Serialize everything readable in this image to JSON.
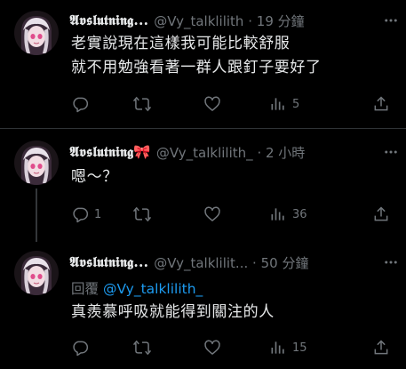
{
  "posts": [
    {
      "name": "𝕬𝖛𝖘𝖑𝖚𝖙𝖓𝖎𝖓𝖌...",
      "handle": "@Vy_talklilith",
      "sep": "·",
      "time": "19 分鐘",
      "lines": [
        "老實說現在這樣我可能比較舒服",
        "就不用勉強看著一群人跟釘子要好了"
      ],
      "stats": {
        "reply": "",
        "repost": "",
        "like": "",
        "views": "5"
      }
    },
    {
      "name": "𝕬𝖛𝖘𝖑𝖚𝖙𝖓𝖎𝖓𝖌",
      "emoji": "🎀",
      "handle": "@Vy_talklilith_",
      "sep": "·",
      "time": "2 小時",
      "lines": [
        "嗯～？"
      ],
      "stats": {
        "reply": "1",
        "repost": "",
        "like": "",
        "views": "36"
      }
    },
    {
      "name": "𝕬𝖛𝖘𝖑𝖚𝖙𝖓𝖎𝖓𝖌...",
      "handle": "@Vy_talklilit...",
      "sep": "·",
      "time": "50 分鐘",
      "reply_prefix": "回覆",
      "reply_to": "@Vy_talklilith_",
      "lines": [
        "真羨慕呼吸就能得到關注的人"
      ],
      "stats": {
        "reply": "",
        "repost": "",
        "like": "",
        "views": "15"
      }
    }
  ],
  "colors": {
    "accent": "#1d9bf0",
    "muted": "#71767b",
    "text": "#e7e9ea",
    "bg": "#000000"
  },
  "icons": [
    "more-icon",
    "reply-icon",
    "repost-icon",
    "like-icon",
    "views-icon",
    "share-icon",
    "avatar"
  ]
}
